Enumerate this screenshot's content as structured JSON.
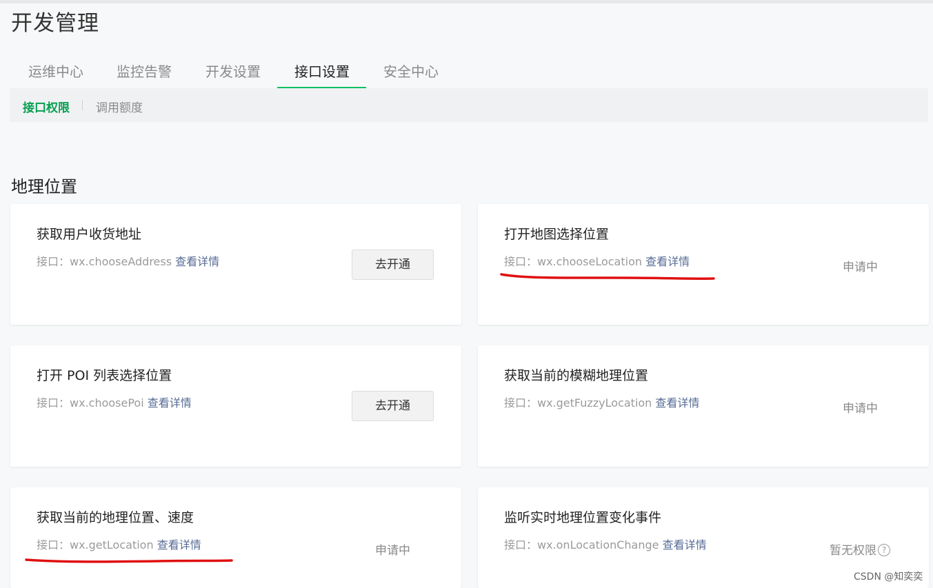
{
  "page": {
    "title": "开发管理"
  },
  "tabs": [
    {
      "label": "运维中心"
    },
    {
      "label": "监控告警"
    },
    {
      "label": "开发设置"
    },
    {
      "label": "接口设置",
      "active": true
    },
    {
      "label": "安全中心"
    }
  ],
  "subtabs": [
    {
      "label": "接口权限",
      "active": true
    },
    {
      "label": "调用额度"
    }
  ],
  "section": {
    "title": "地理位置"
  },
  "common": {
    "detail_label": "查看详情"
  },
  "cards": [
    {
      "title": "获取用户收货地址",
      "api": "接口：wx.chooseAddress",
      "action": "去开通"
    },
    {
      "title": "打开地图选择位置",
      "api": "接口：wx.chooseLocation",
      "status": "申请中"
    },
    {
      "title": "打开 POI 列表选择位置",
      "api": "接口：wx.choosePoi",
      "action": "去开通"
    },
    {
      "title": "获取当前的模糊地理位置",
      "api": "接口：wx.getFuzzyLocation",
      "status": "申请中"
    },
    {
      "title": "获取当前的地理位置、速度",
      "api": "接口：wx.getLocation",
      "status": "申请中"
    },
    {
      "title": "监听实时地理位置变化事件",
      "api": "接口：wx.onLocationChange",
      "status": "暂无权限",
      "status_icon": "question-circle-icon"
    }
  ],
  "colors": {
    "accent_green": "#07c160",
    "link_blue": "#576b95",
    "annotation_red": "#e01010"
  },
  "watermark": "CSDN @知奕奕"
}
